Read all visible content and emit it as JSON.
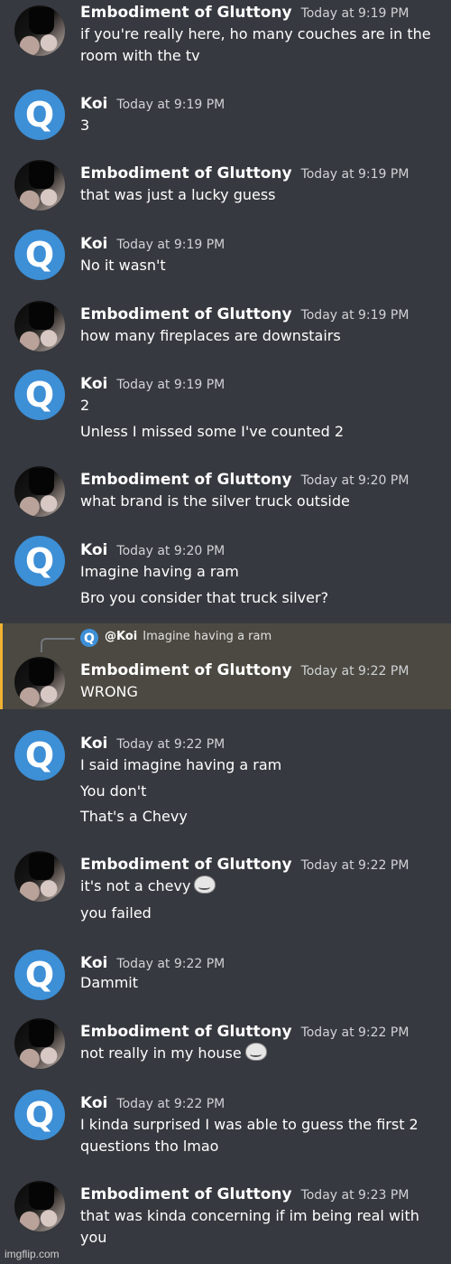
{
  "messages": [
    {
      "author": "Embodiment of Gluttony",
      "avatar": "gluttony",
      "timestamp": "Today at 9:19 PM",
      "lines": [
        "if you're really here, ho many couches are in the",
        "room with the tv"
      ]
    },
    {
      "author": "Koi",
      "avatar": "koi",
      "timestamp": "Today at 9:19 PM",
      "lines": [
        "3"
      ]
    },
    {
      "author": "Embodiment of Gluttony",
      "avatar": "gluttony",
      "timestamp": "Today at 9:19 PM",
      "lines": [
        "that was just a lucky guess"
      ]
    },
    {
      "author": "Koi",
      "avatar": "koi",
      "timestamp": "Today at 9:19 PM",
      "lines": [
        "No it wasn't"
      ]
    },
    {
      "author": "Embodiment of Gluttony",
      "avatar": "gluttony",
      "timestamp": "Today at 9:19 PM",
      "lines": [
        "how many fireplaces are downstairs"
      ]
    },
    {
      "author": "Koi",
      "avatar": "koi",
      "timestamp": "Today at 9:19 PM",
      "lines": [
        "2",
        "Unless I missed some I've counted 2"
      ]
    },
    {
      "author": "Embodiment of Gluttony",
      "avatar": "gluttony",
      "timestamp": "Today at 9:20 PM",
      "lines": [
        "what brand is the silver truck outside"
      ]
    },
    {
      "author": "Koi",
      "avatar": "koi",
      "timestamp": "Today at 9:20 PM",
      "lines": [
        "Imagine having a ram",
        "Bro you consider that truck silver?"
      ]
    },
    {
      "author": "Embodiment of Gluttony",
      "avatar": "gluttony",
      "timestamp": "Today at 9:22 PM",
      "lines": [
        "WRONG"
      ],
      "reply": {
        "mention": "@Koi",
        "text": "Imagine having a ram"
      }
    },
    {
      "author": "Koi",
      "avatar": "koi",
      "timestamp": "Today at 9:22 PM",
      "lines": [
        "I said imagine having a ram",
        "You don't",
        "That's a Chevy"
      ]
    },
    {
      "author": "Embodiment of Gluttony",
      "avatar": "gluttony",
      "timestamp": "Today at 9:22 PM",
      "lines": [
        "it's not a chevy",
        "you failed"
      ],
      "emoji_after_line": 0,
      "emoji": "trollface-emoji"
    },
    {
      "author": "Koi",
      "avatar": "koi",
      "timestamp": "Today at 9:22 PM",
      "lines": [
        "Dammit"
      ]
    },
    {
      "author": "Embodiment of Gluttony",
      "avatar": "gluttony",
      "timestamp": "Today at 9:22 PM",
      "lines": [
        "not really in my house"
      ],
      "emoji_after_line": 0,
      "emoji": "trollface-emoji"
    },
    {
      "author": "Koi",
      "avatar": "koi",
      "timestamp": "Today at 9:22 PM",
      "lines": [
        "I kinda surprised I was able to guess the first 2",
        "questions tho lmao"
      ]
    },
    {
      "author": "Embodiment of Gluttony",
      "avatar": "gluttony",
      "timestamp": "Today at 9:23 PM",
      "lines": [
        "that was kinda concerning if im being real with",
        "you"
      ]
    }
  ],
  "koi_avatar_letter": "Q",
  "watermark": "imgflip.com",
  "colors": {
    "background": "#36393f",
    "highlight": "#4b4941",
    "highlight_bar": "#f0b232",
    "koi_avatar": "#3d8fd6"
  }
}
